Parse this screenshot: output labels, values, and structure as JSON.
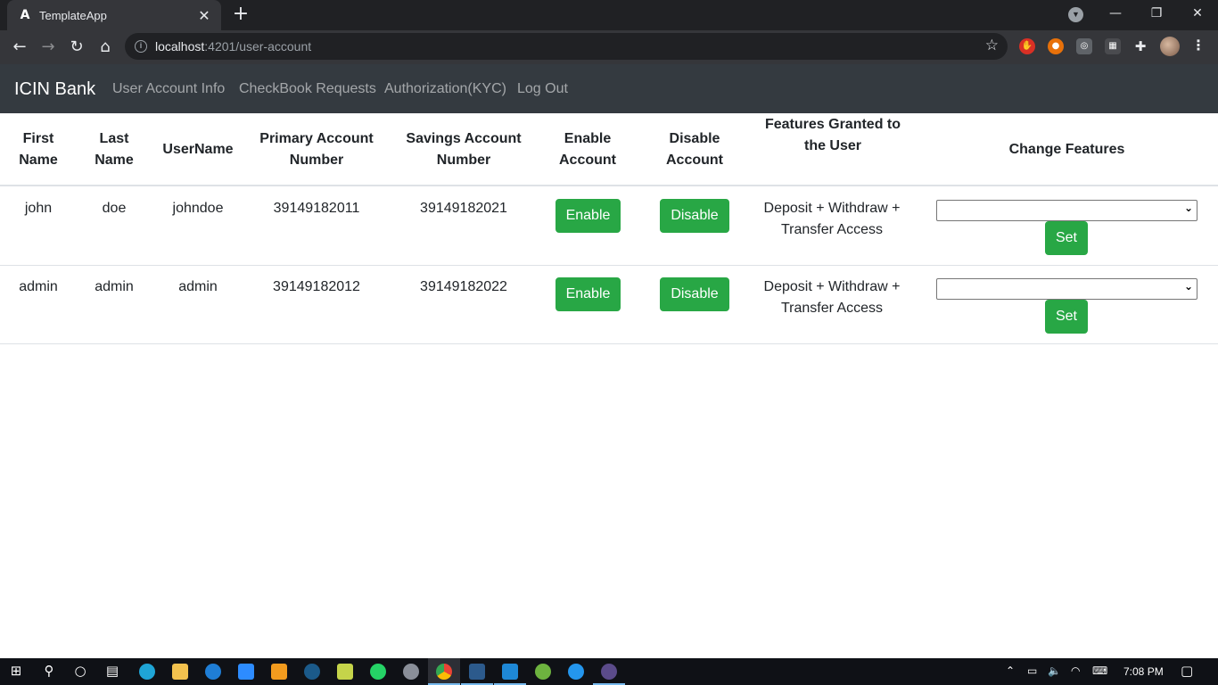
{
  "browser": {
    "tab_title": "TemplateApp",
    "tab_favicon": "angular-icon",
    "url_host": "localhost",
    "url_rest": ":4201/user-account"
  },
  "navbar": {
    "brand": "ICIN Bank",
    "links": [
      "User Account Info",
      "CheckBook Requests",
      "Authorization(KYC)",
      "Log Out"
    ]
  },
  "table": {
    "headers": {
      "first_name": "First Name",
      "last_name": "Last Name",
      "username": "UserName",
      "primary": "Primary Account Number",
      "savings": "Savings Account Number",
      "enable": "Enable Account",
      "disable": "Disable Account",
      "features": "Features Granted to the User",
      "change": "Change Features"
    },
    "rows": [
      {
        "first_name": "john",
        "last_name": "doe",
        "username": "johndoe",
        "primary": "39149182011",
        "savings": "39149182021",
        "enable_label": "Enable",
        "disable_label": "Disable",
        "features": "Deposit + Withdraw + Transfer Access",
        "select_value": "",
        "set_label": "Set"
      },
      {
        "first_name": "admin",
        "last_name": "admin",
        "username": "admin",
        "primary": "39149182012",
        "savings": "39149182022",
        "enable_label": "Enable",
        "disable_label": "Disable",
        "features": "Deposit + Withdraw + Transfer Access",
        "select_value": "",
        "set_label": "Set"
      }
    ]
  },
  "taskbar": {
    "clock": "7:08 PM"
  },
  "colors": {
    "navbar_bg": "#343a40",
    "success": "#28a745",
    "chrome_dark": "#202124",
    "chrome_toolbar": "#35363a"
  }
}
